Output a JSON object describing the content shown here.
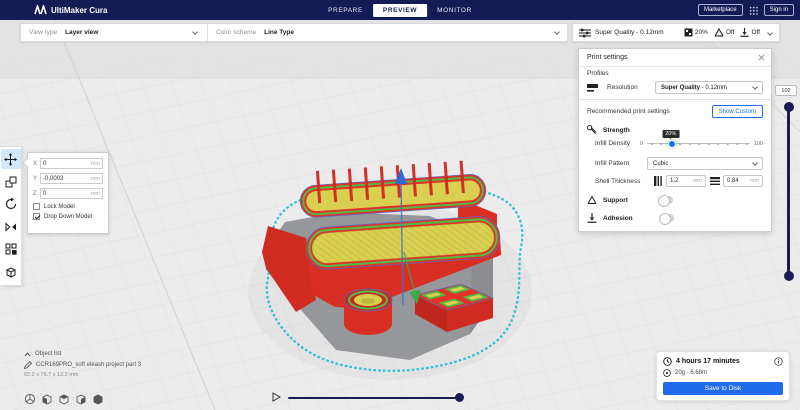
{
  "app": {
    "title": "UltiMaker Cura"
  },
  "colors": {
    "topbar_navy": "#141c55",
    "accent_blue": "#196ef0",
    "slider_navy": "#1b1c52",
    "model_red": "#e23127",
    "model_yellow": "#d9d052",
    "model_green": "#54b847",
    "skirt_cyan": "#2bc0d4",
    "base_gray": "#95979a"
  },
  "header": {
    "tabs": [
      {
        "label": "PREPARE",
        "active": false
      },
      {
        "label": "PREVIEW",
        "active": true
      },
      {
        "label": "MONITOR",
        "active": false
      }
    ],
    "marketplace_label": "Marketplace",
    "sign_in_label": "Sign in"
  },
  "view_toolbar": {
    "view_type_label": "View type",
    "view_type_value": "Layer view",
    "color_scheme_label": "Color scheme",
    "color_scheme_value": "Line Type"
  },
  "print_setup_summary": {
    "profile": "Super Quality - 0.12mm",
    "infill": "20%",
    "support": "Off",
    "adhesion": "Off"
  },
  "print_settings": {
    "title": "Print settings",
    "profiles_label": "Profiles",
    "resolution_label": "Resolution",
    "resolution_value_bold": "Super Quality",
    "resolution_value_rest": " - 0.12mm",
    "recommended_label": "Recommended print settings",
    "show_custom_label": "Show Custom",
    "strength": {
      "title": "Strength",
      "infill_density_label": "Infill Density",
      "infill_density_min": "0",
      "infill_density_max": "100",
      "infill_density_value": "20%",
      "infill_pattern_label": "Infill Pattern",
      "infill_pattern_value": "Cubic",
      "shell_thickness_label": "Shell Thickness",
      "wall_thickness_value": "1.2",
      "top_bottom_thickness_value": "0.84"
    },
    "support_label": "Support",
    "adhesion_label": "Adhesion"
  },
  "transform_panel": {
    "x_label": "X",
    "x_value": "0",
    "y_label": "Y",
    "y_value": "-0.0003",
    "z_label": "Z",
    "z_value": "0",
    "lock_model_label": "Lock Model",
    "drop_down_model_label": "Drop Down Model"
  },
  "object_list": {
    "title": "Object list",
    "file_name": "CCR169PRO_soft eleash project part 3",
    "dimensions": "82.2 x 76.7 x 12.2 mm"
  },
  "job_info": {
    "print_time": "4 hours 17 minutes",
    "material": "20g · 6.68m",
    "save_button_label": "Save to Disk"
  },
  "layer_slider": {
    "current_layer": "102"
  },
  "units": {
    "mm": "mm"
  }
}
